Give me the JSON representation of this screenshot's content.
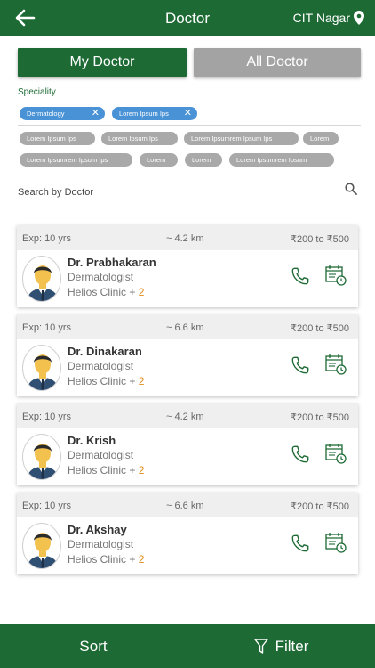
{
  "header": {
    "title": "Doctor",
    "location": "CIT Nagar"
  },
  "toggle": {
    "my_doctor": "My Doctor",
    "all_doctor": "All Doctor"
  },
  "speciality": {
    "label": "Speciality",
    "selected": [
      "Dermatology",
      "Lorem Ipsum Ips"
    ],
    "options": [
      "Lorem Ipsum Ips",
      "Lorem Ipsum Ips",
      "Lorem Ipsumrem Ipsum Ips",
      "Lorem",
      "Lorem Ipsumrem Ipsum Ips",
      "Lorem",
      "Lorem",
      "Lorem Ipsumrem Ipsum"
    ]
  },
  "search": {
    "placeholder": "Search by Doctor"
  },
  "doctors": [
    {
      "exp": "Exp: 10 yrs",
      "distance": "~ 4.2 km",
      "fee": "₹200 to ₹500",
      "name": "Dr. Prabhakaran",
      "specialty": "Dermatologist",
      "clinic": "Helios Clinic + ",
      "clinic_count": "2"
    },
    {
      "exp": "Exp: 10 yrs",
      "distance": "~ 6.6 km",
      "fee": "₹200 to ₹500",
      "name": "Dr. Dinakaran",
      "specialty": "Dermatologist",
      "clinic": "Helios Clinic + ",
      "clinic_count": "2"
    },
    {
      "exp": "Exp: 10 yrs",
      "distance": "~ 4.2 km",
      "fee": "₹200 to ₹500",
      "name": "Dr. Krish",
      "specialty": "Dermatologist",
      "clinic": "Helios Clinic + ",
      "clinic_count": "2"
    },
    {
      "exp": "Exp: 10 yrs",
      "distance": "~ 6.6 km",
      "fee": "₹200 to ₹500",
      "name": "Dr. Akshay",
      "specialty": "Dermatologist",
      "clinic": "Helios Clinic + ",
      "clinic_count": "2"
    }
  ],
  "bottom": {
    "sort": "Sort",
    "filter": "Filter"
  },
  "colors": {
    "primary": "#1d6a34",
    "chip_selected": "#4a92d6",
    "chip_option": "#a9a9a9",
    "accent_count": "#e08a16"
  },
  "icons": [
    "back-arrow-icon",
    "location-pin-icon",
    "close-icon",
    "search-icon",
    "doctor-avatar-icon",
    "phone-icon",
    "calendar-clock-icon",
    "filter-icon"
  ]
}
